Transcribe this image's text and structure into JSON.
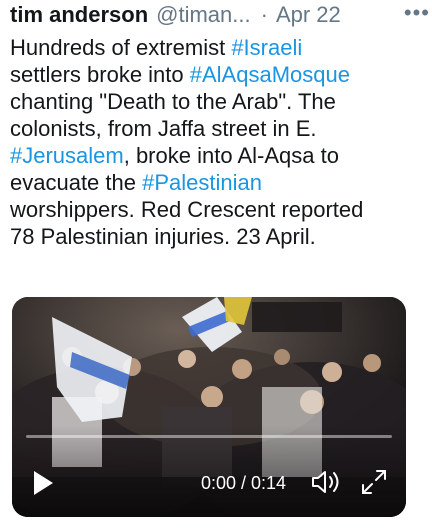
{
  "tweet": {
    "author_name": "tim anderson",
    "handle": "@timan...",
    "separator": "·",
    "date": "Apr 22",
    "more_icon": "more-horizontal-icon",
    "more_glyph": "•••",
    "lines": [
      [
        {
          "t": "Hundreds of extremist "
        },
        {
          "t": "#Israeli",
          "tag": true
        }
      ],
      [
        {
          "t": "settlers broke into "
        },
        {
          "t": "#AlAqsaMosque",
          "tag": true
        }
      ],
      [
        {
          "t": "chanting \"Death to the Arab\". The"
        }
      ],
      [
        {
          "t": "colonists, from Jaffa street in E."
        }
      ],
      [
        {
          "t": "#Jerusalem",
          "tag": true
        },
        {
          "t": ", broke into Al-Aqsa to"
        }
      ],
      [
        {
          "t": "evacuate the "
        },
        {
          "t": "#Palestinian",
          "tag": true
        }
      ],
      [
        {
          "t": "worshippers. Red Crescent reported"
        }
      ],
      [
        {
          "t": "78 Palestinian injuries. 23 April."
        }
      ]
    ]
  },
  "video": {
    "current_time": "0:00",
    "duration": "0:14",
    "time_label": "0:00 / 0:14",
    "progress": 0.0,
    "icons": {
      "play": "play-icon",
      "volume": "volume-icon",
      "fullscreen": "fullscreen-expand-icon"
    }
  },
  "colors": {
    "link": "#1b95e0",
    "text": "#14171a",
    "muted": "#657786",
    "video_controls": "#ffffff"
  }
}
